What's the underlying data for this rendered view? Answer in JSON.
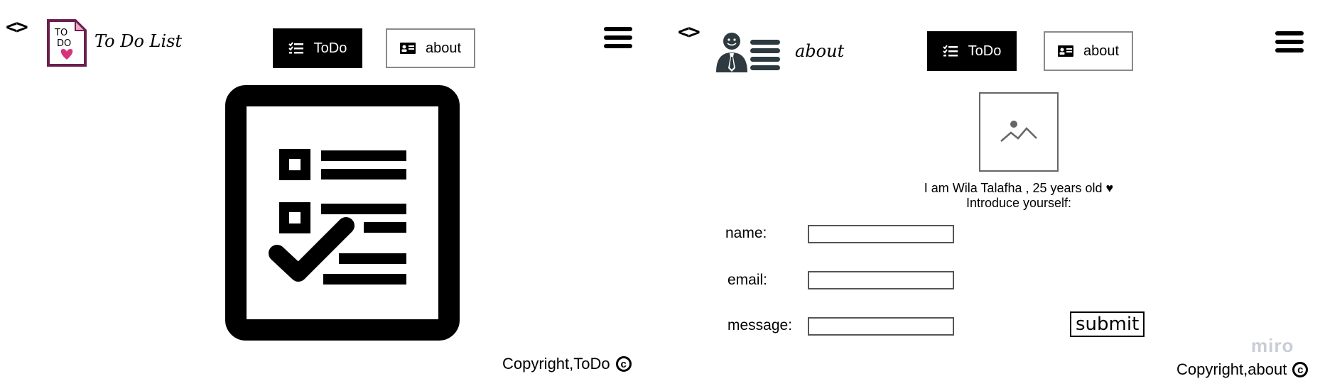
{
  "left": {
    "brand": {
      "title": "To Do List",
      "logo_text_top": "TO",
      "logo_text_bottom": "DO"
    },
    "nav": {
      "todo_label": "ToDo",
      "about_label": "about"
    },
    "copyright": {
      "text": "Copyright,ToDo",
      "symbol": "c"
    }
  },
  "right": {
    "brand": {
      "title": "about"
    },
    "nav": {
      "todo_label": "ToDo",
      "about_label": "about"
    },
    "intro": {
      "line1": "I am Wila Talafha , 25 years old ♥",
      "line2": "Introduce yourself:"
    },
    "form": {
      "name_label": "name:",
      "email_label": "email:",
      "message_label": "message:",
      "submit_label": "submit"
    },
    "watermark": "miro",
    "copyright": {
      "text": "Copyright,about",
      "symbol": "c"
    }
  },
  "colors": {
    "accent_dark": "#000000",
    "logo_border": "#6b1f4f",
    "heart": "#d6337a",
    "avatar": "#2f3a40"
  }
}
